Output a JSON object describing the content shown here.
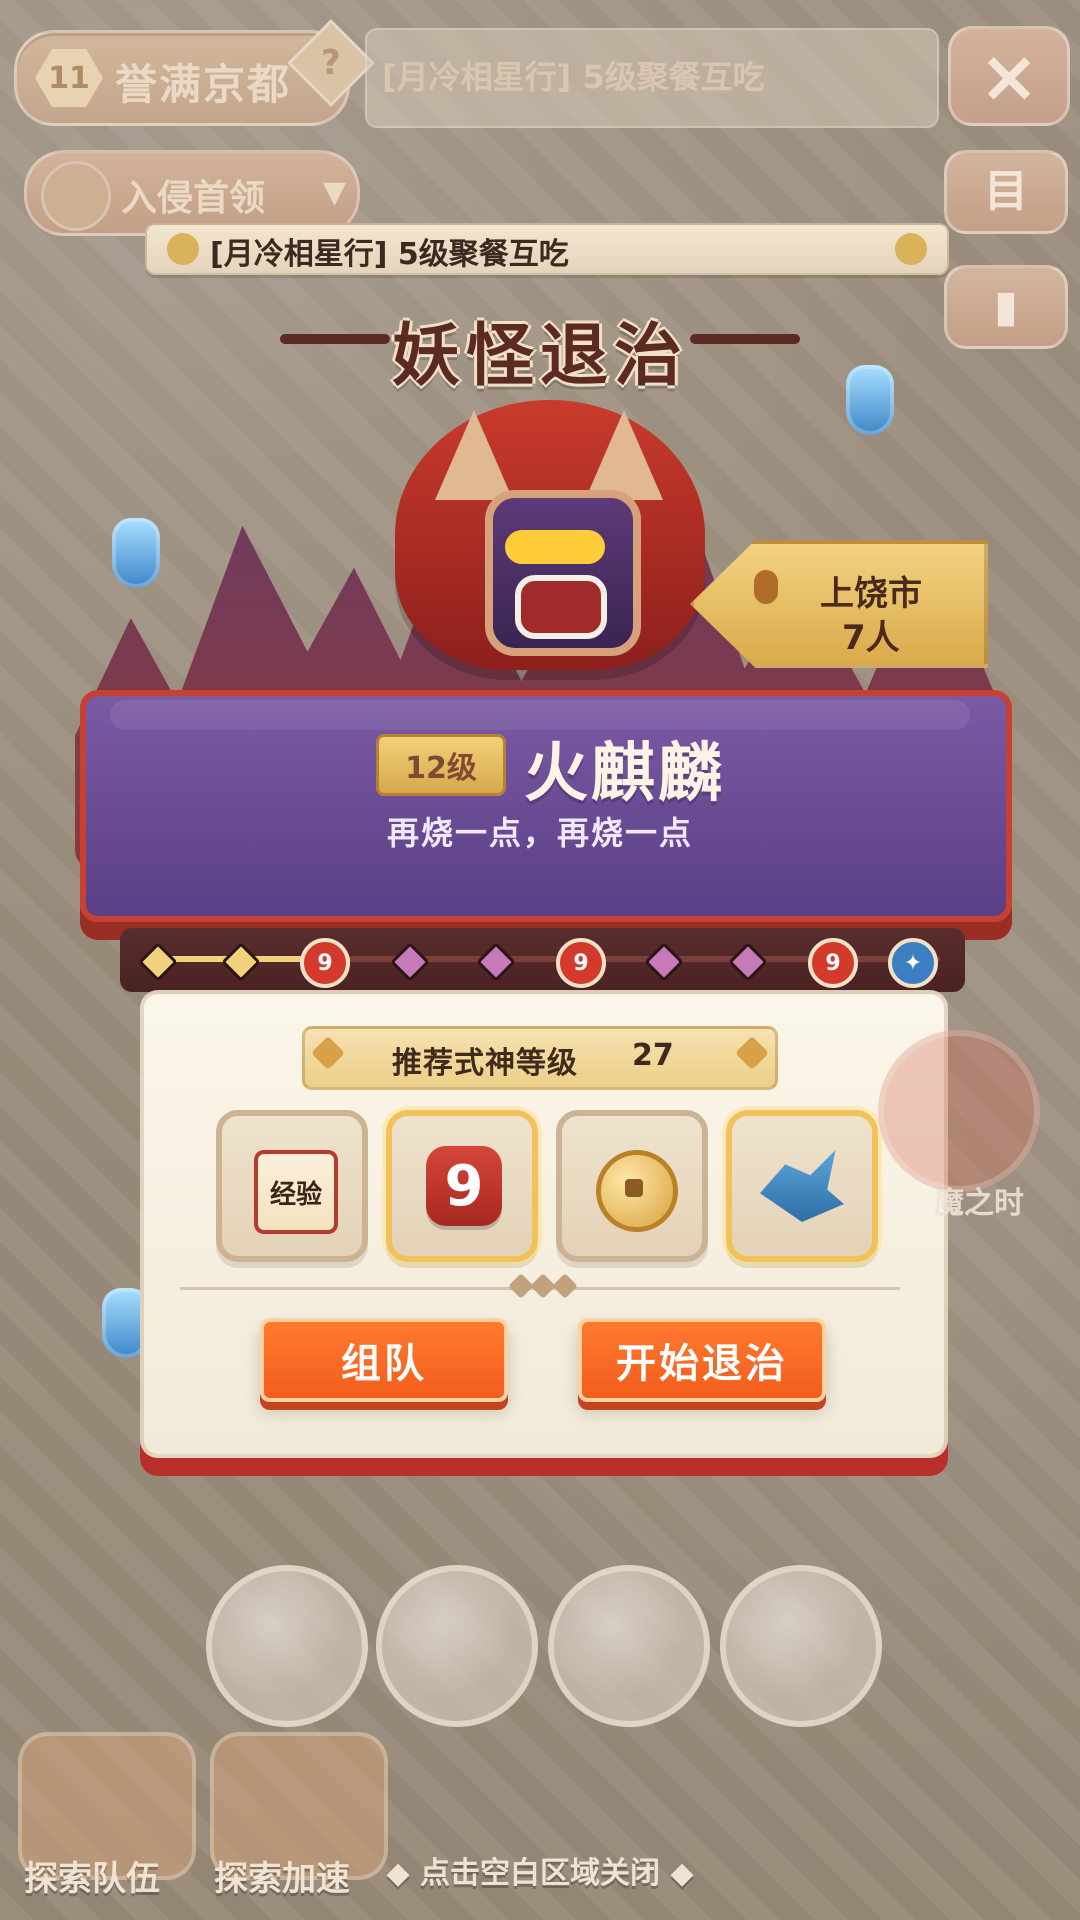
{
  "top": {
    "area_level": "11",
    "area_name": "誉满京都",
    "help_icon": "question-mark-icon",
    "banner_text": "[月冷相星行] 5级聚餐互吃",
    "close_icon": "close-icon"
  },
  "left": {
    "invasion_label": "入侵首领",
    "invasion_icon": "boss-mask-icon",
    "dropdown_icon": "chevron-down-icon"
  },
  "right_side_buttons": [
    {
      "icon": "book-icon",
      "glyph": "目"
    },
    {
      "icon": "card-icon",
      "glyph": "▮"
    }
  ],
  "quest": {
    "text": "[月冷相星行] 5级聚餐互吃"
  },
  "title": "妖怪退治",
  "boss": {
    "level_badge": "12级",
    "name": "火麒麟",
    "quote": "再烧一点，再烧一点"
  },
  "location": {
    "city": "上饶市",
    "players": "7人"
  },
  "progress": {
    "markers": [
      "done",
      "done",
      "milestone",
      "todo",
      "todo",
      "milestone",
      "todo",
      "todo",
      "milestone",
      "boss"
    ]
  },
  "rewards": {
    "recommended_label": "推荐式神等级",
    "recommended_value": "27",
    "items": [
      {
        "name": "exp-scroll",
        "label": "经验"
      },
      {
        "name": "nine-token",
        "label": "9"
      },
      {
        "name": "coin",
        "label": ""
      },
      {
        "name": "bird-charm",
        "label": ""
      }
    ]
  },
  "actions": {
    "team": "组队",
    "start": "开始退治"
  },
  "bottom": {
    "left_button": "探索队伍",
    "mid_button": "探索加速",
    "hint": "◆ 点击空白区域关闭 ◆",
    "side_event_label": "魔之时"
  }
}
